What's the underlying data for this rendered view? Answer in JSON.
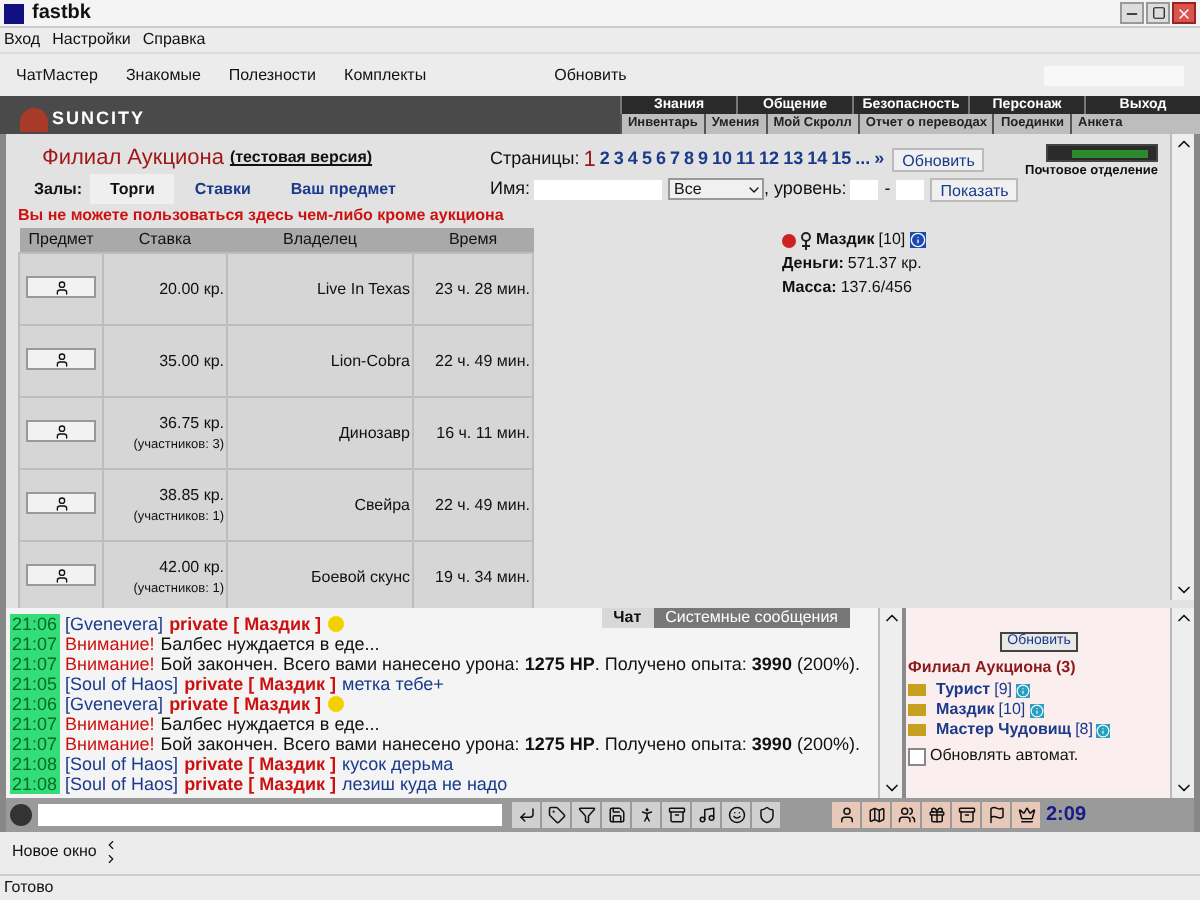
{
  "window": {
    "title": "fastbk"
  },
  "menu": [
    "Вход",
    "Настройки",
    "Справка"
  ],
  "toolbar": [
    "ЧатМастер",
    "Знакомые",
    "Полезности",
    "Комплекты",
    "Обновить"
  ],
  "game_header": {
    "logo": "SUNCITY",
    "top_nav": [
      "Знания",
      "Общение",
      "Безопасность",
      "Персонаж",
      "Выход"
    ],
    "sub_nav": [
      "Инвентарь",
      "Умения",
      "Мой Скролл",
      "Отчет о переводах",
      "Поединки",
      "Анкета"
    ]
  },
  "auction": {
    "title": "Филиал Аукциона",
    "subtitle": "(тестовая версия)",
    "pages_label": "Страницы:",
    "pages": [
      {
        "label": "1",
        "selected": true
      },
      {
        "label": "2",
        "selected": false
      },
      {
        "label": "3",
        "selected": false
      },
      {
        "label": "4",
        "selected": false
      },
      {
        "label": "5",
        "selected": false
      },
      {
        "label": "6",
        "selected": false
      },
      {
        "label": "7",
        "selected": false
      },
      {
        "label": "8",
        "selected": false
      },
      {
        "label": "9",
        "selected": false
      },
      {
        "label": "10",
        "selected": false
      },
      {
        "label": "11",
        "selected": false
      },
      {
        "label": "12",
        "selected": false
      },
      {
        "label": "13",
        "selected": false
      },
      {
        "label": "14",
        "selected": false
      },
      {
        "label": "15",
        "selected": false
      },
      {
        "label": "...",
        "selected": false
      },
      {
        "label": "»",
        "selected": false
      }
    ],
    "refresh_button": "Обновить",
    "halls_label": "Залы:",
    "tabs": [
      {
        "label": "Торги",
        "selected": true
      },
      {
        "label": "Ставки",
        "selected": false
      },
      {
        "label": "Ваш предмет",
        "selected": false
      }
    ],
    "filter": {
      "name_label": "Имя:",
      "category": "Все",
      "level_label": ", уровень:",
      "dash": "-",
      "button": "Показать"
    },
    "warning": "Вы не можете пользоваться здесь чем-либо кроме аукциона",
    "mail": "Почтовое отделение",
    "table": {
      "columns": [
        "Предмет",
        "Ставка",
        "Владелец",
        "Время"
      ],
      "rows": [
        {
          "price": "20.00 кр.",
          "owner": "Live In Texas",
          "time": "23 ч. 28 мин."
        },
        {
          "price": "35.00 кр.",
          "owner": "Lion-Cobra",
          "time": "22 ч. 49 мин."
        },
        {
          "price": "36.75 кр.",
          "participants": "(участников: 3)",
          "owner": "Динозавр",
          "time": "16 ч. 11 мин."
        },
        {
          "price": "38.85 кр.",
          "participants": "(участников: 1)",
          "owner": "Свейра",
          "time": "22 ч. 49 мин."
        },
        {
          "price": "42.00 кр.",
          "participants": "(участников: 1)",
          "owner": "Боевой скунс",
          "time": "19 ч. 34 мин."
        }
      ]
    },
    "player": {
      "name": "Маздик",
      "level": "[10]",
      "money_label": "Деньги:",
      "money": "571.37 кр.",
      "mass_label": "Масса:",
      "mass": "137.6/456"
    }
  },
  "chat": {
    "tabs": [
      {
        "label": "Чат",
        "selected": true
      },
      {
        "label": "Системные сообщения",
        "selected": false
      }
    ],
    "messages": [
      {
        "kind": "private",
        "time": "21:06",
        "sender": "[Gvenevera]",
        "tag": "private [ Маздик ]",
        "smiley": true
      },
      {
        "kind": "notice",
        "time": "21:07",
        "label": "Внимание!",
        "text": "Балбес нуждается в еде..."
      },
      {
        "kind": "notice",
        "time": "21:07",
        "label": "Внимание!",
        "text": "Бой закончен. Всего вами нанесено урона: **1275 HP**. Получено опыта: **3990** (200%)."
      },
      {
        "kind": "private",
        "time": "21:05",
        "sender": "[Soul of Haos]",
        "tag": "private [ Маздик ]",
        "text": "метка тебе+",
        "smiley": false
      },
      {
        "kind": "private",
        "time": "21:06",
        "sender": "[Gvenevera]",
        "tag": "private [ Маздик ]",
        "smiley": true
      },
      {
        "kind": "notice",
        "time": "21:07",
        "label": "Внимание!",
        "text": "Балбес нуждается в еде..."
      },
      {
        "kind": "notice",
        "time": "21:07",
        "label": "Внимание!",
        "text": "Бой закончен. Всего вами нанесено урона: **1275 HP**. Получено опыта: **3990** (200%)."
      },
      {
        "kind": "private",
        "time": "21:08",
        "sender": "[Soul of Haos]",
        "tag": "private [ Маздик ]",
        "text": "кусок дерьма",
        "smiley": false
      },
      {
        "kind": "private",
        "time": "21:08",
        "sender": "[Soul of Haos]",
        "tag": "private [ Маздик ]",
        "text": "лезиш куда не надо",
        "smiley": false
      }
    ]
  },
  "room": {
    "button": "Обновить",
    "title": "Филиал Аукциона (3)",
    "users": [
      {
        "name": "Турист",
        "level": "[9]"
      },
      {
        "name": "Маздик",
        "level": "[10]"
      },
      {
        "name": "Мастер Чудовищ",
        "level": "[8]"
      }
    ],
    "auto_refresh": {
      "label": "Обновлять автомат.",
      "checked": false
    }
  },
  "clock": "2:09",
  "bottom_tab": "Новое окно",
  "status_bar": "Готово"
}
